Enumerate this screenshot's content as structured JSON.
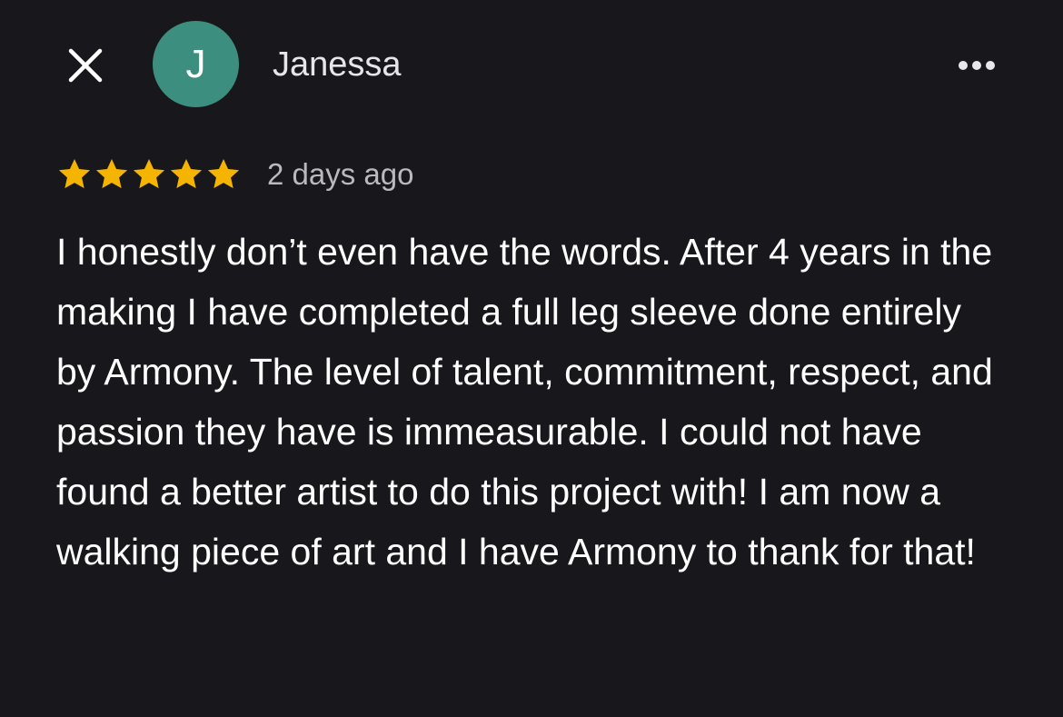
{
  "header": {
    "close_icon": "close-icon",
    "avatar_letter": "J",
    "avatar_color": "#3c8f7f",
    "reviewer_name": "Janessa",
    "more_icon": "more-horizontal-icon"
  },
  "review": {
    "rating": 5,
    "rating_max": 5,
    "star_color": "#f4b400",
    "date": "2 days ago",
    "text": "I honestly don’t even have the words. After 4 years in the making I have completed a full leg sleeve done entirely by Armony. The level of talent, commitment, respect, and passion they have is immeasurable. I could not have found a better artist to do this project with! I am now a walking piece of art and I have Armony to thank for that!"
  }
}
